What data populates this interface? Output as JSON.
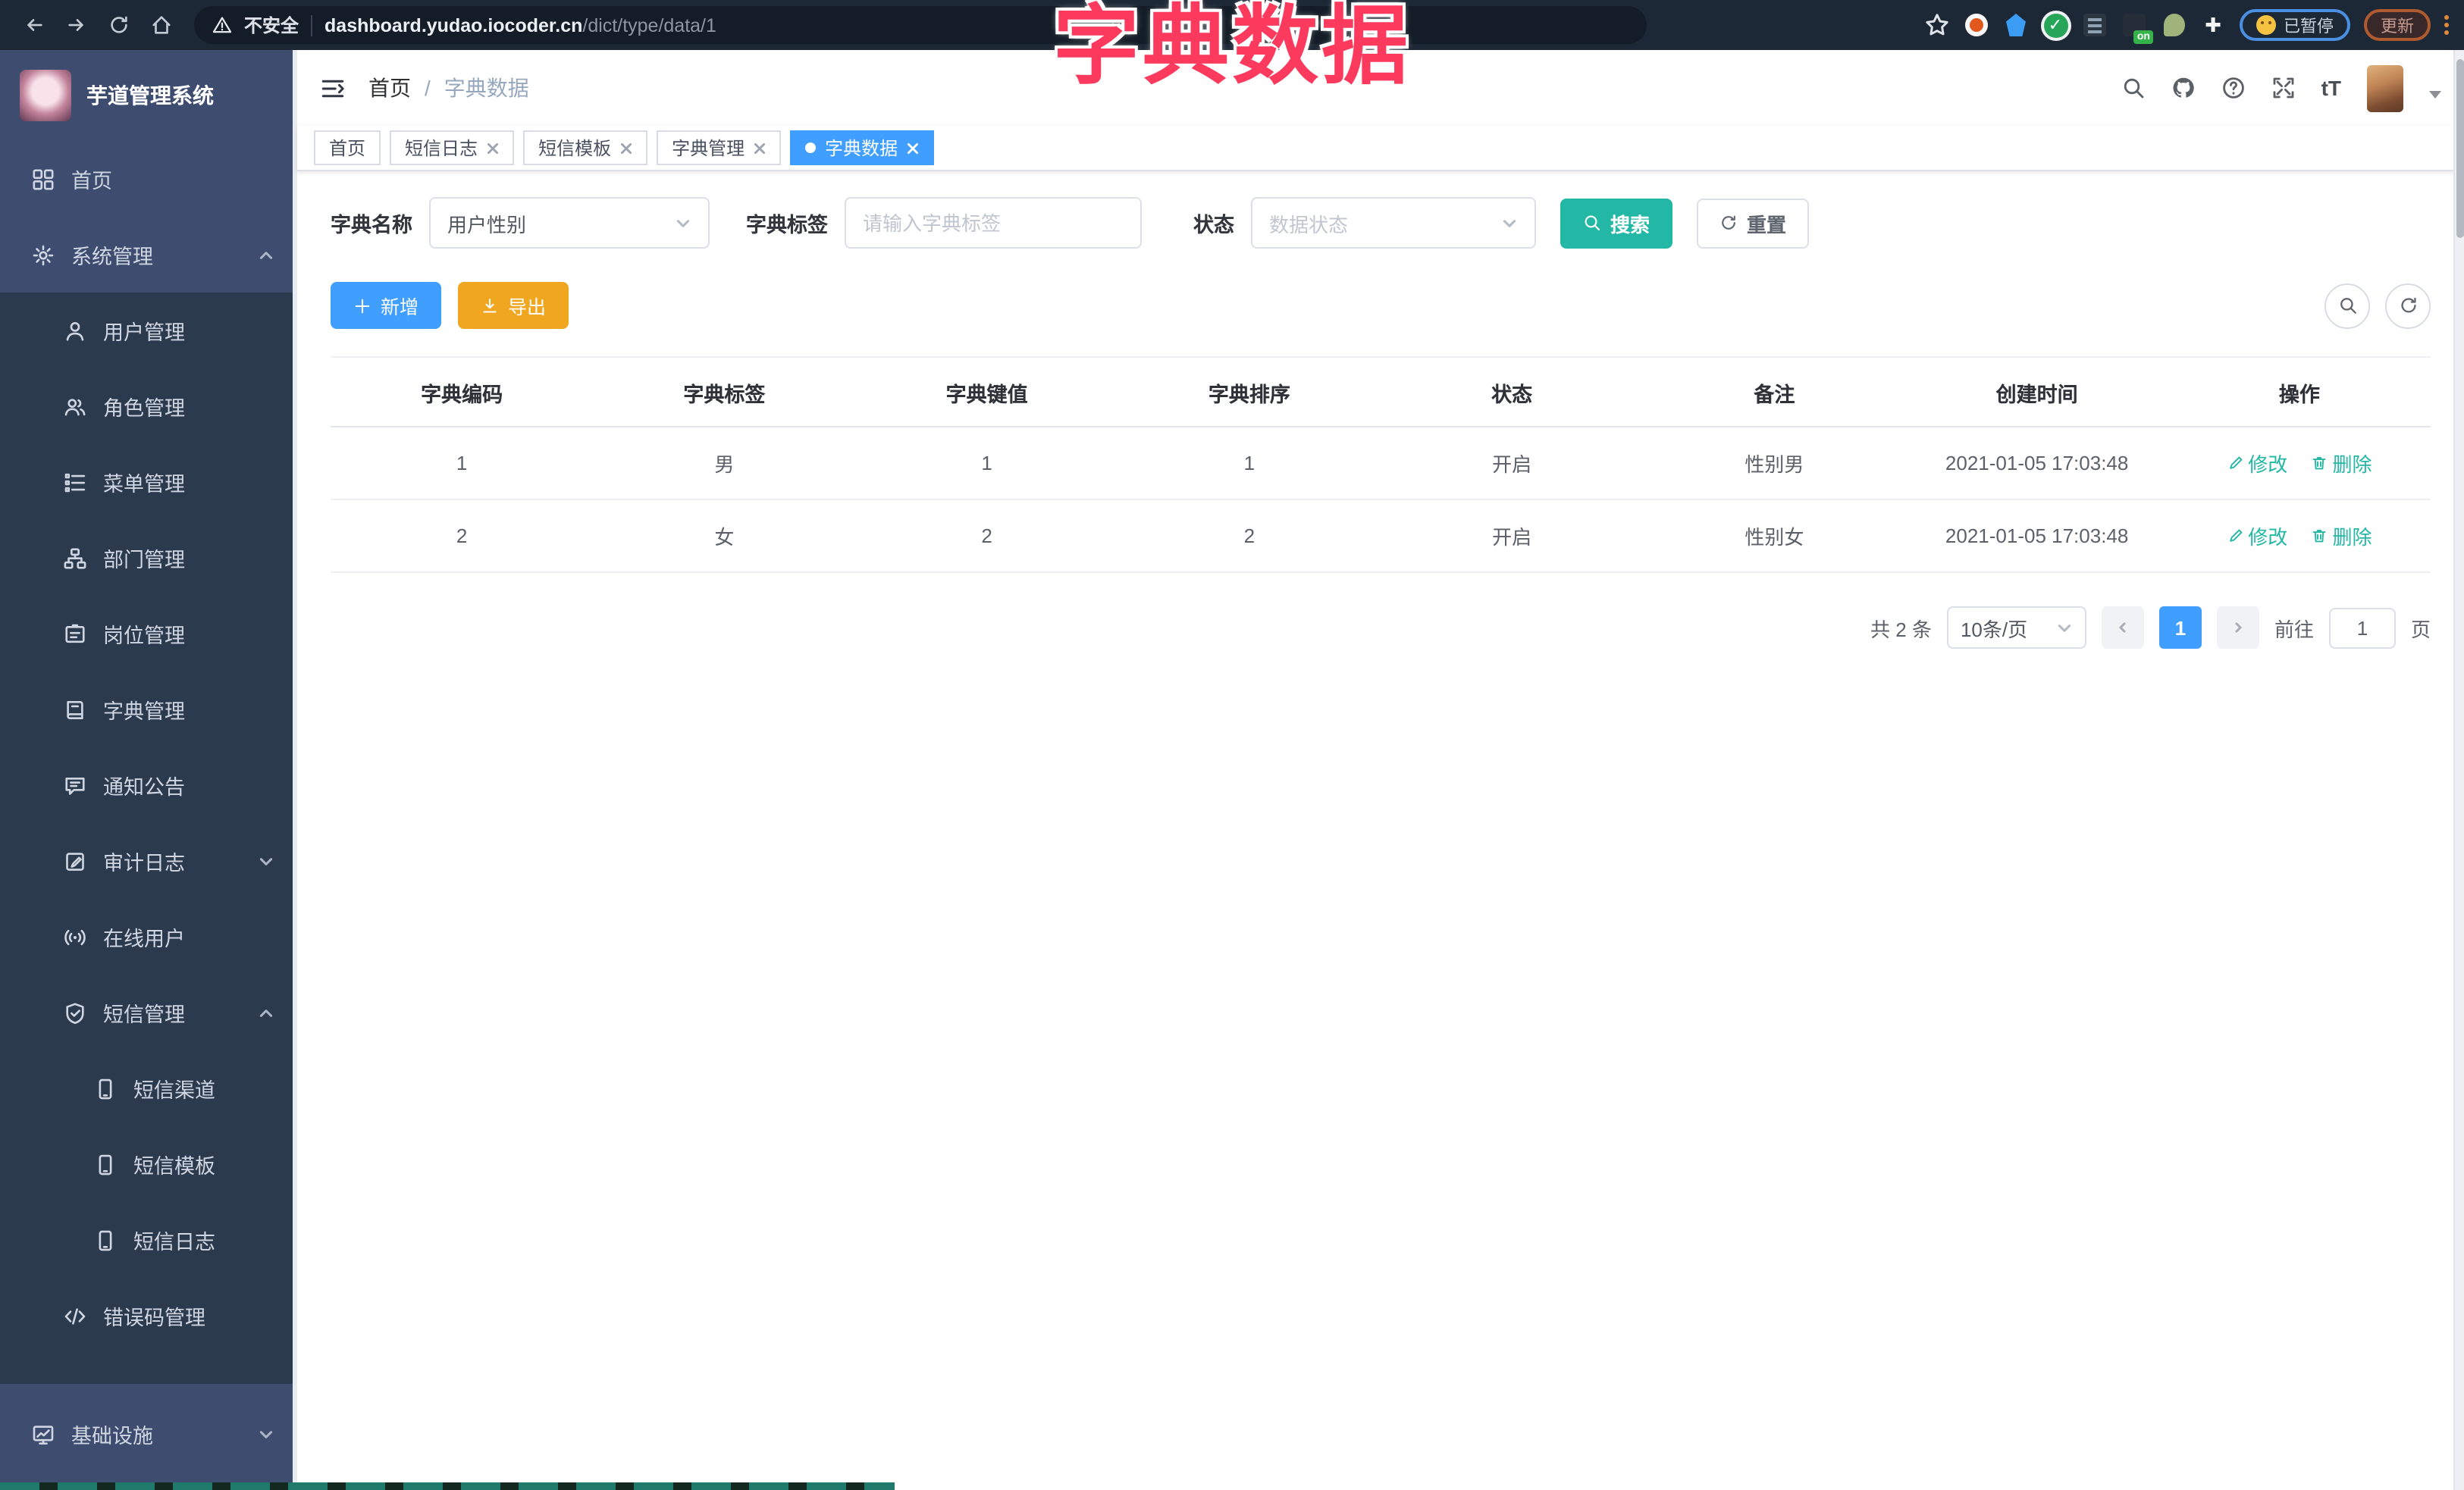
{
  "chrome": {
    "security_label": "不安全",
    "url_domain": "dashboard.yudao.iocoder.cn",
    "url_path": "/dict/type/data/1",
    "on_badge": "on",
    "paused_label": "已暂停",
    "update_label": "更新"
  },
  "annotation": {
    "title": "字典数据",
    "color": "#FB3A5E"
  },
  "sidebar": {
    "title": "芋道管理系统",
    "items": [
      {
        "label": "首页",
        "icon": "dashboard-icon"
      },
      {
        "label": "系统管理",
        "icon": "gear-icon",
        "chevron": "up"
      },
      {
        "label": "用户管理",
        "icon": "user-icon"
      },
      {
        "label": "角色管理",
        "icon": "users-icon"
      },
      {
        "label": "菜单管理",
        "icon": "menu-list-icon"
      },
      {
        "label": "部门管理",
        "icon": "org-tree-icon"
      },
      {
        "label": "岗位管理",
        "icon": "post-badge-icon"
      },
      {
        "label": "字典管理",
        "icon": "dict-book-icon"
      },
      {
        "label": "通知公告",
        "icon": "notice-bubble-icon"
      },
      {
        "label": "审计日志",
        "icon": "audit-log-icon",
        "chevron": "down"
      },
      {
        "label": "在线用户",
        "icon": "online-signal-icon"
      },
      {
        "label": "短信管理",
        "icon": "sms-shield-icon",
        "chevron": "up"
      },
      {
        "label": "短信渠道",
        "icon": "phone-icon"
      },
      {
        "label": "短信模板",
        "icon": "phone-icon"
      },
      {
        "label": "短信日志",
        "icon": "phone-icon"
      },
      {
        "label": "错误码管理",
        "icon": "code-icon"
      },
      {
        "label": "基础设施",
        "icon": "infra-chart-icon",
        "chevron": "down"
      }
    ]
  },
  "header": {
    "breadcrumb": {
      "home": "首页",
      "sep": "/",
      "current": "字典数据"
    },
    "fontsize_glyph": "tT",
    "qmark_glyph": "?"
  },
  "tabs": {
    "items": [
      {
        "label": "首页"
      },
      {
        "label": "短信日志"
      },
      {
        "label": "短信模板"
      },
      {
        "label": "字典管理"
      },
      {
        "label": "字典数据"
      }
    ]
  },
  "filters": {
    "name_label": "字典名称",
    "name_value": "用户性别",
    "tag_label": "字典标签",
    "tag_placeholder": "请输入字典标签",
    "status_label": "状态",
    "status_placeholder": "数据状态",
    "search_label": "搜索",
    "reset_label": "重置"
  },
  "toolbar": {
    "add_label": "新增",
    "export_label": "导出"
  },
  "table": {
    "headers": [
      "字典编码",
      "字典标签",
      "字典键值",
      "字典排序",
      "状态",
      "备注",
      "创建时间",
      "操作"
    ],
    "rows": [
      {
        "code": "1",
        "label": "男",
        "value": "1",
        "sort": "1",
        "status": "开启",
        "remark": "性别男",
        "created": "2021-01-05 17:03:48"
      },
      {
        "code": "2",
        "label": "女",
        "value": "2",
        "sort": "2",
        "status": "开启",
        "remark": "性别女",
        "created": "2021-01-05 17:03:48"
      }
    ],
    "edit_label": "修改",
    "delete_label": "删除"
  },
  "pagination": {
    "total_text": "共 2 条",
    "size_text": "10条/页",
    "current": "1",
    "goto_label": "前往",
    "goto_value": "1",
    "unit_label": "页"
  },
  "colors": {
    "primary": "#409EFF",
    "teal": "#23B7A5",
    "warning": "#F0A61F",
    "sidebar": "#2C3A4D",
    "sidebar_light": "#3D4C6F"
  }
}
